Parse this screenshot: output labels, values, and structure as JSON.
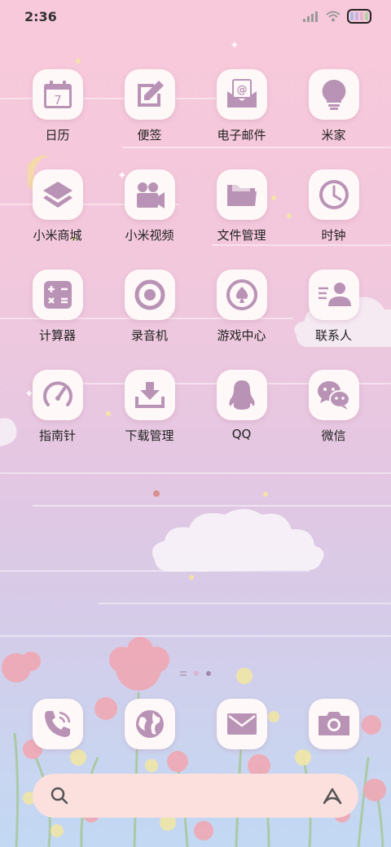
{
  "status_bar": {
    "time": "2:36",
    "battery_colors": [
      "#a7bde8",
      "#c8b2e0",
      "#e5b3cb",
      "#b7cfa8"
    ]
  },
  "apps": [
    {
      "label": "日历",
      "icon": "calendar-icon",
      "badge": "7"
    },
    {
      "label": "便签",
      "icon": "notes-icon"
    },
    {
      "label": "电子邮件",
      "icon": "email-icon"
    },
    {
      "label": "米家",
      "icon": "lightbulb-icon"
    },
    {
      "label": "小米商城",
      "icon": "layers-icon"
    },
    {
      "label": "小米视频",
      "icon": "video-camera-icon"
    },
    {
      "label": "文件管理",
      "icon": "folder-icon"
    },
    {
      "label": "时钟",
      "icon": "clock-icon"
    },
    {
      "label": "计算器",
      "icon": "calculator-icon"
    },
    {
      "label": "录音机",
      "icon": "record-icon"
    },
    {
      "label": "游戏中心",
      "icon": "spade-icon"
    },
    {
      "label": "联系人",
      "icon": "contacts-icon"
    },
    {
      "label": "指南针",
      "icon": "compass-gauge-icon"
    },
    {
      "label": "下载管理",
      "icon": "download-icon"
    },
    {
      "label": "QQ",
      "icon": "penguin-icon"
    },
    {
      "label": "微信",
      "icon": "wechat-icon"
    }
  ],
  "dock": [
    {
      "icon": "phone-icon"
    },
    {
      "icon": "globe-icon"
    },
    {
      "icon": "mail-icon"
    },
    {
      "icon": "camera-icon"
    }
  ],
  "theme": {
    "icon_color": "#b993b6",
    "icon_bg": "#fff8f8",
    "search_bg": "#fbe0de"
  }
}
